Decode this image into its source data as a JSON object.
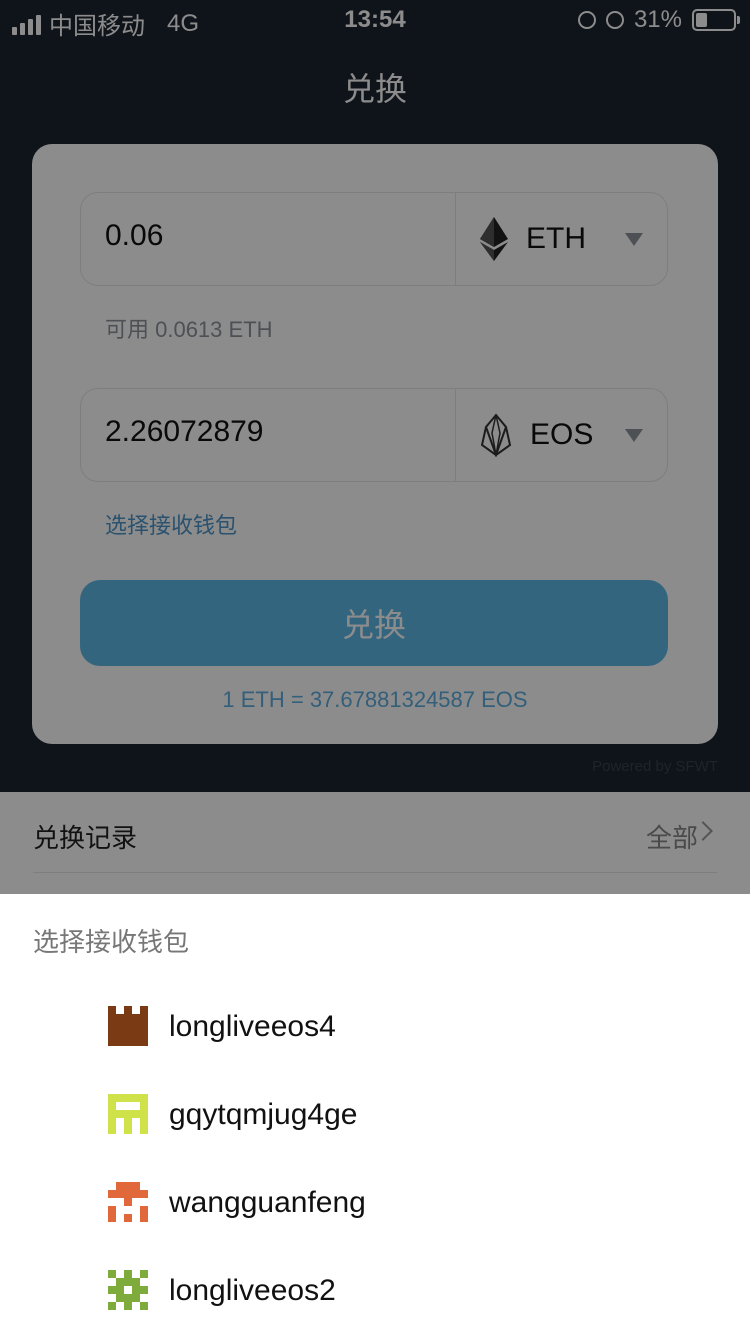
{
  "status_bar": {
    "carrier": "中国移动",
    "network": "4G",
    "time": "13:54",
    "battery": "31%"
  },
  "nav": {
    "title": "兑换"
  },
  "exchange": {
    "from": {
      "amount": "0.06",
      "symbol": "ETH"
    },
    "available": "可用 0.0613 ETH",
    "to": {
      "amount": "2.26072879",
      "symbol": "EOS"
    },
    "choose_wallet_link": "选择接收钱包",
    "button_label": "兑换",
    "rate": "1 ETH = 37.67881324587 EOS",
    "powered_by": "Powered by SFWT"
  },
  "records": {
    "title": "兑换记录",
    "all_label": "全部"
  },
  "wallet_sheet": {
    "title": "选择接收钱包",
    "wallets": [
      {
        "name": "longliveeos4",
        "color": "#7a3a14"
      },
      {
        "name": "gqytqmjug4ge",
        "color": "#cfe24a"
      },
      {
        "name": "wangguanfeng",
        "color": "#e0683a"
      },
      {
        "name": "longliveeos2",
        "color": "#7fab3c"
      }
    ]
  },
  "colors": {
    "header_bg": "#1d2330",
    "accent": "#5eb8e8",
    "link": "#4d95c9"
  }
}
